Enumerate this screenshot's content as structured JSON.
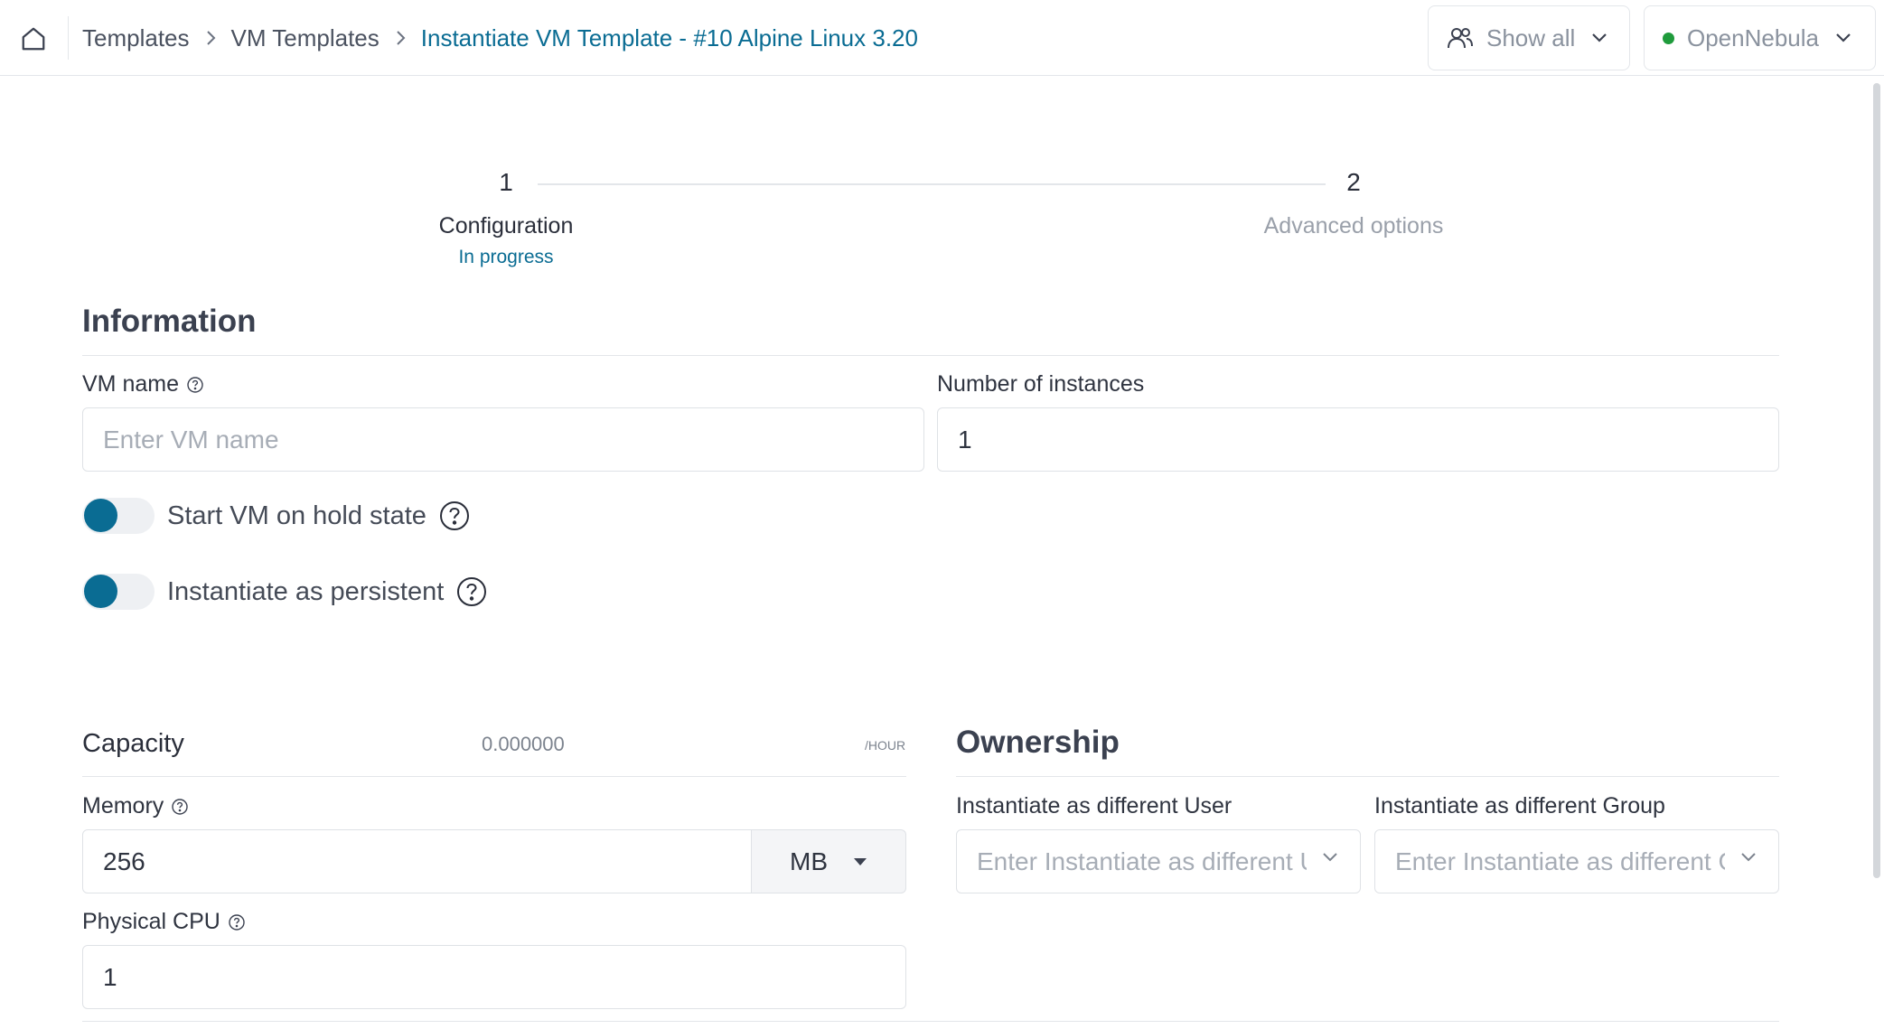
{
  "breadcrumb": {
    "items": [
      "Templates",
      "VM Templates"
    ],
    "current": "Instantiate VM Template - #10 Alpine Linux 3.20"
  },
  "header": {
    "users_filter_label": "Show all",
    "zone_label": "OpenNebula",
    "zone_status_color": "#1f9b3c"
  },
  "stepper": {
    "steps": [
      {
        "number": "1",
        "title": "Configuration",
        "status": "In progress"
      },
      {
        "number": "2",
        "title": "Advanced options",
        "status": ""
      }
    ]
  },
  "information": {
    "title": "Information",
    "vm_name_label": "VM name",
    "vm_name_placeholder": "Enter VM name",
    "vm_name_value": "",
    "instances_label": "Number of instances",
    "instances_value": "1",
    "hold_label": "Start VM on hold state",
    "persistent_label": "Instantiate as persistent"
  },
  "capacity": {
    "title": "Capacity",
    "cost": "0.000000",
    "cost_unit": "/HOUR",
    "memory_label": "Memory",
    "memory_value": "256",
    "memory_unit": "MB",
    "cpu_label": "Physical CPU",
    "cpu_value": "1"
  },
  "ownership": {
    "title": "Ownership",
    "user_label": "Instantiate as different User",
    "user_placeholder": "Enter Instantiate as different User",
    "group_label": "Instantiate as different Group",
    "group_placeholder": "Enter Instantiate as different Group"
  },
  "colors": {
    "accent": "#0a6c93",
    "border": "#dfe2e6"
  }
}
